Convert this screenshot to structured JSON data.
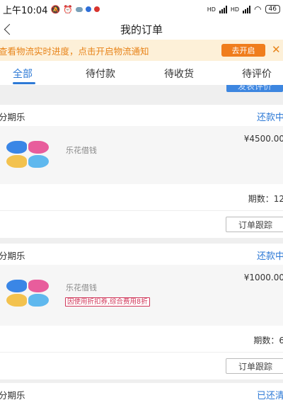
{
  "status_bar": {
    "time": "上午10:04",
    "battery": "46",
    "net1": "HD",
    "net2": "HD"
  },
  "nav": {
    "title": "我的订单"
  },
  "banner": {
    "text": "查看物流实时进度，点击开启物流通知",
    "button": "去开启",
    "close": "✕"
  },
  "tabs": [
    {
      "label": "全部"
    },
    {
      "label": "待付款"
    },
    {
      "label": "待收货"
    },
    {
      "label": "待评价"
    }
  ],
  "prev_card": {
    "button": "发表评价"
  },
  "orders": [
    {
      "shop": "分期乐",
      "status": "还款中",
      "product": "乐花借钱",
      "price": "¥4500.00",
      "tag": "",
      "periods": "期数：12",
      "track": "订单跟踪"
    },
    {
      "shop": "分期乐",
      "status": "还款中",
      "product": "乐花借钱",
      "price": "¥1000.00",
      "tag": "因使用折扣券,综合费用8折",
      "periods": "期数：6",
      "track": "订单跟踪"
    },
    {
      "shop": "分期乐",
      "status": "已还清"
    }
  ],
  "colors": {
    "accent": "#2e7ad6",
    "banner_bg": "#fdf0d8",
    "banner_btn": "#f07d1c"
  }
}
